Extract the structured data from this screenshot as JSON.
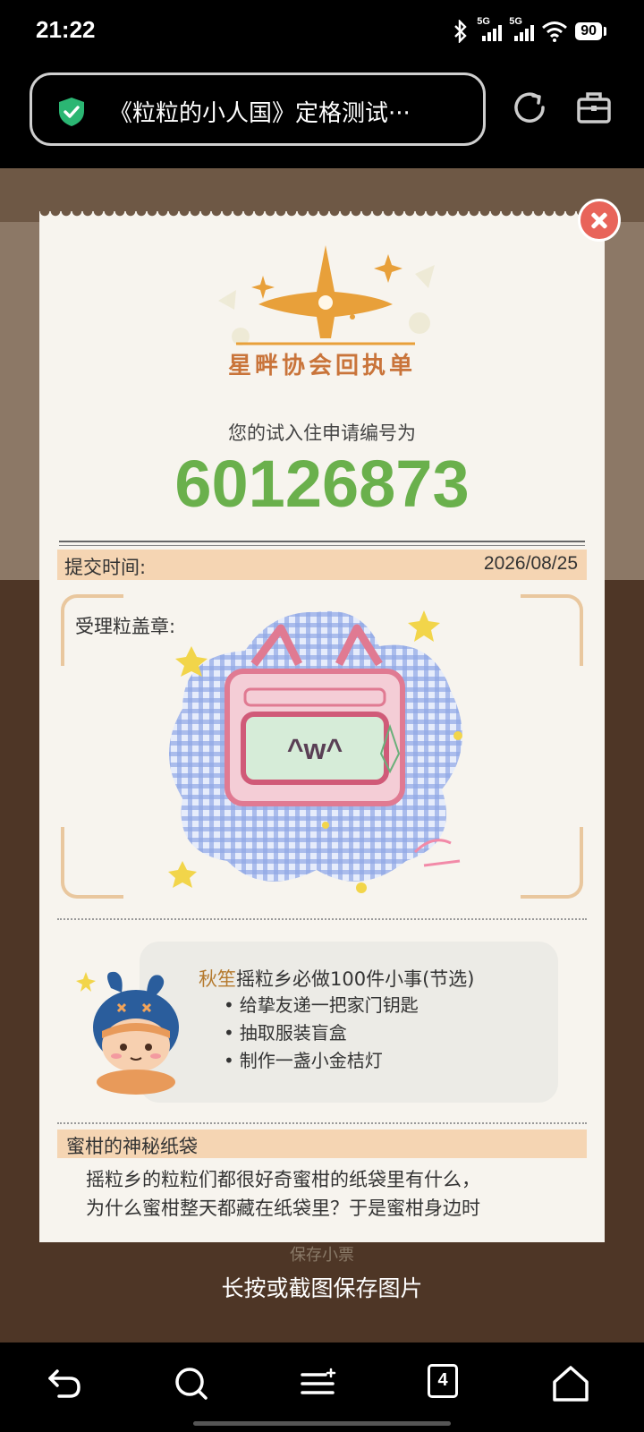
{
  "status_bar": {
    "time": "21:22",
    "battery": "90",
    "network_1": "5G",
    "network_2": "5G",
    "icons": [
      "bluetooth-icon",
      "signal-icon",
      "signal-icon",
      "wifi-icon",
      "battery-icon"
    ]
  },
  "browser": {
    "url_title": "《粒粒的小人国》定格测试···",
    "icons": [
      "shield-check-icon",
      "reload-icon",
      "toolbox-icon"
    ]
  },
  "receipt": {
    "logo_title": "星畔协会回执单",
    "application_label": "您的试入住申请编号为",
    "application_number": "60126873",
    "submit_time_label": "提交时间:",
    "submit_time_value": "2026/08/25",
    "stamp_label": "受理粒盖章:",
    "stamp_face": "^w^",
    "todo": {
      "name": "秋笙",
      "title_rest": "摇粒乡必做100件小事(节选)",
      "items": [
        "给挚友递一把家门钥匙",
        "抽取服装盲盒",
        "制作一盏小金桔灯"
      ]
    },
    "section_title": "蜜柑的神秘纸袋",
    "section_lines": [
      "摇粒乡的粒粒们都很好奇蜜柑的纸袋里有什么，",
      "为什么蜜柑整天都藏在纸袋里？于是蜜柑身边时"
    ]
  },
  "save_button_label": "保存小票",
  "hint_text": "长按或截图保存图片",
  "nav": {
    "tab_count": "4",
    "icons": [
      "back-icon",
      "search-icon",
      "menu-icon",
      "tabs-icon",
      "home-icon"
    ]
  },
  "colors": {
    "accent_green": "#6ab04c",
    "tan": "#f5d5b3",
    "close_red": "#e8645a",
    "logo_orange": "#e8a03a"
  }
}
